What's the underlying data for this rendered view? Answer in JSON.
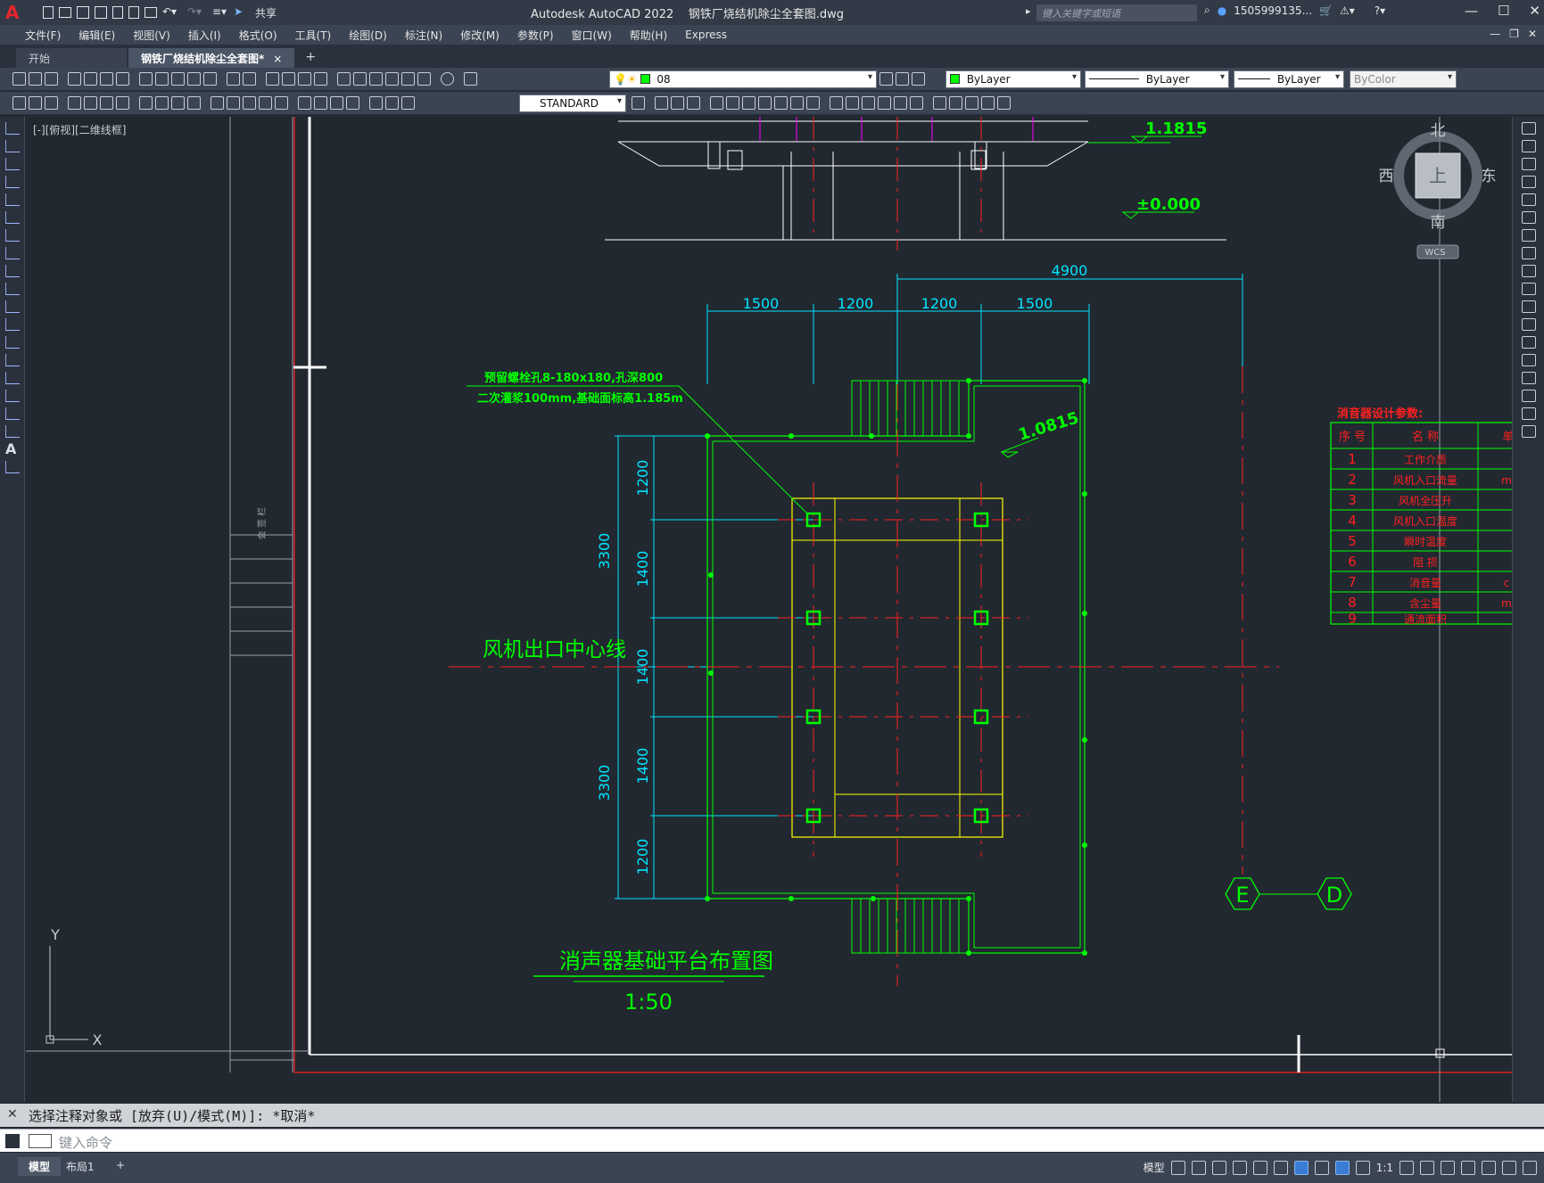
{
  "titlebar": {
    "title": "Autodesk AutoCAD 2022    钢铁厂烧结机除尘全套图.dwg",
    "share_label": "共享",
    "search_placeholder": "键入关键字或短语",
    "user_label": "1505999135..."
  },
  "menu": {
    "items": [
      "文件(F)",
      "编辑(E)",
      "视图(V)",
      "插入(I)",
      "格式(O)",
      "工具(T)",
      "绘图(D)",
      "标注(N)",
      "修改(M)",
      "参数(P)",
      "窗口(W)",
      "帮助(H)",
      "Express"
    ]
  },
  "tabs": {
    "start": "开始",
    "active": "钢铁厂烧结机除尘全套图*",
    "close": "×",
    "add": "+"
  },
  "toolbar": {
    "layer_value": "08",
    "color_value": "ByLayer",
    "linetype_value": "ByLayer",
    "lineweight_value": "ByLayer",
    "plotstyle_value": "ByColor",
    "textstyle_value": "STANDARD"
  },
  "viewport": {
    "label": "[-][俯视][二维线框]",
    "viewcube": {
      "north": "北",
      "south": "南",
      "east": "东",
      "west": "西",
      "top": "上",
      "wcs": "WCS"
    },
    "ucs": {
      "x": "X",
      "y": "Y"
    }
  },
  "drawing": {
    "colors": {
      "green": "#00ff00",
      "cyan": "#00e5ff",
      "yellow": "#ffff00",
      "red": "#ff2020",
      "magenta": "#ff00ff",
      "white": "#ffffff"
    },
    "elevation_top": "1.1815",
    "elevation_zero": "±0.000",
    "elevation_platform": "1.0815",
    "dim_total": "4900",
    "dims_top": [
      "1500",
      "1200",
      "1200",
      "1500"
    ],
    "dims_left_outer": [
      "3300",
      "3300"
    ],
    "dims_left_inner": [
      "1200",
      "1400",
      "1400",
      "1400",
      "1200"
    ],
    "note_line1": "预留螺栓孔8-180x180,孔深800",
    "note_line2": "二次灌浆100mm,基础面标高1.185m",
    "centerline_label": "风机出口中心线",
    "drawing_title": "消声器基础平台布置图",
    "scale": "1:50",
    "axis_e": "E",
    "axis_d": "D",
    "side_label": "会 签 栏",
    "table_title": "消音器设计参数:",
    "table_headers": [
      "序 号",
      "名    称",
      "单"
    ],
    "table_rows": [
      {
        "no": "1",
        "name": "工作介质",
        "unit": ""
      },
      {
        "no": "2",
        "name": "风机入口流量",
        "unit": "m"
      },
      {
        "no": "3",
        "name": "风机全压升",
        "unit": ""
      },
      {
        "no": "4",
        "name": "风机入口温度",
        "unit": ""
      },
      {
        "no": "5",
        "name": "瞬时温度",
        "unit": ""
      },
      {
        "no": "6",
        "name": "阻    损",
        "unit": ""
      },
      {
        "no": "7",
        "name": "消音量",
        "unit": "c"
      },
      {
        "no": "8",
        "name": "含尘量",
        "unit": "m"
      },
      {
        "no": "9",
        "name": "通流面积",
        "unit": ""
      }
    ]
  },
  "command": {
    "history": "选择注释对象或 [放弃(U)/模式(M)]: *取消*",
    "placeholder": "键入命令"
  },
  "status": {
    "tab_model": "模型",
    "tab_layout": "布局1",
    "tab_add": "+",
    "model_label": "模型",
    "scale_label": "1:1"
  }
}
